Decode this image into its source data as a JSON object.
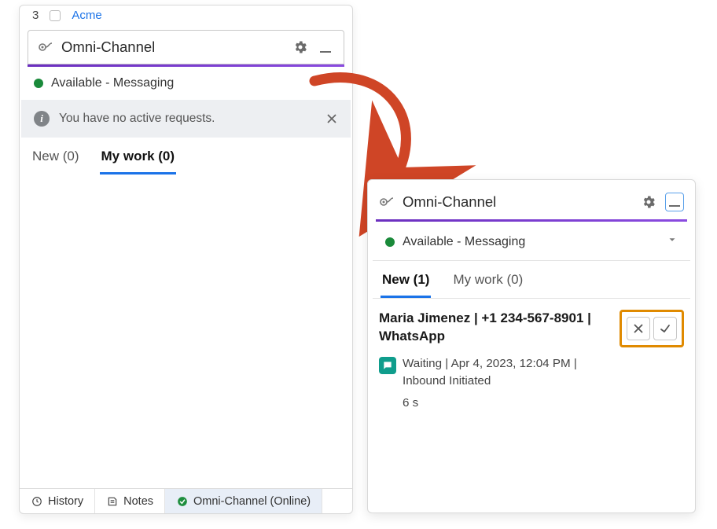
{
  "left": {
    "tabbar": {
      "number": "3",
      "link": "Acme"
    },
    "header": {
      "title": "Omni-Channel"
    },
    "status": "Available - Messaging",
    "banner": "You have no active requests.",
    "tabs": {
      "new": "New (0)",
      "mywork": "My work (0)"
    },
    "footer": {
      "history": "History",
      "notes": "Notes",
      "omni": "Omni-Channel (Online)"
    }
  },
  "right": {
    "header": {
      "title": "Omni-Channel"
    },
    "status": "Available - Messaging",
    "tabs": {
      "new": "New (1)",
      "mywork": "My work (0)"
    },
    "item": {
      "title": "Maria Jimenez | +1 234-567-8901 | WhatsApp",
      "line": "Waiting | Apr 4, 2023, 12:04 PM | Inbound Initiated",
      "elapsed": "6 s"
    }
  }
}
